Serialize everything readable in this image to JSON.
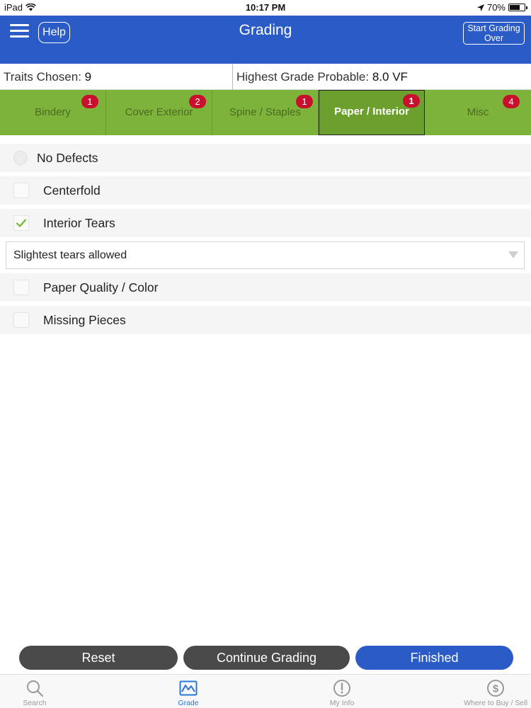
{
  "status_bar": {
    "device": "iPad",
    "time": "10:17 PM",
    "battery": "70%",
    "battery_level": 0.7
  },
  "nav": {
    "help_label": "Help",
    "title": "Grading",
    "start_over_line1": "Start Grading",
    "start_over_line2": "Over"
  },
  "info": {
    "traits_label": "Traits Chosen:",
    "traits_value": "9",
    "grade_label": "Highest Grade Probable:",
    "grade_value": "8.0 VF"
  },
  "tabs": [
    {
      "label": "Bindery",
      "badge": "1"
    },
    {
      "label": "Cover Exterior",
      "badge": "2"
    },
    {
      "label": "Spine / Staples",
      "badge": "1"
    },
    {
      "label": "Paper / Interior",
      "badge": "1",
      "active": true
    },
    {
      "label": "Misc",
      "badge": "4"
    }
  ],
  "list": {
    "no_defects": "No Defects",
    "items": [
      {
        "label": "Centerfold",
        "checked": false
      },
      {
        "label": "Interior Tears",
        "checked": true
      },
      {
        "label": "Paper Quality / Color",
        "checked": false
      },
      {
        "label": "Missing Pieces",
        "checked": false
      }
    ],
    "interior_tears_selection": "Slightest tears allowed"
  },
  "buttons": {
    "reset": "Reset",
    "continue": "Continue Grading",
    "finished": "Finished"
  },
  "tabbar": [
    {
      "label": "Search",
      "icon": "search-icon"
    },
    {
      "label": "Grade",
      "icon": "grade-icon",
      "active": true
    },
    {
      "label": "My Info",
      "icon": "info-icon"
    },
    {
      "label": "Where to Buy / Sell",
      "icon": "dollar-icon"
    }
  ],
  "colors": {
    "brand_blue": "#2a5bc6",
    "tab_green": "#7db33a",
    "badge_red": "#c8102e",
    "check_green": "#6dbb2a"
  }
}
